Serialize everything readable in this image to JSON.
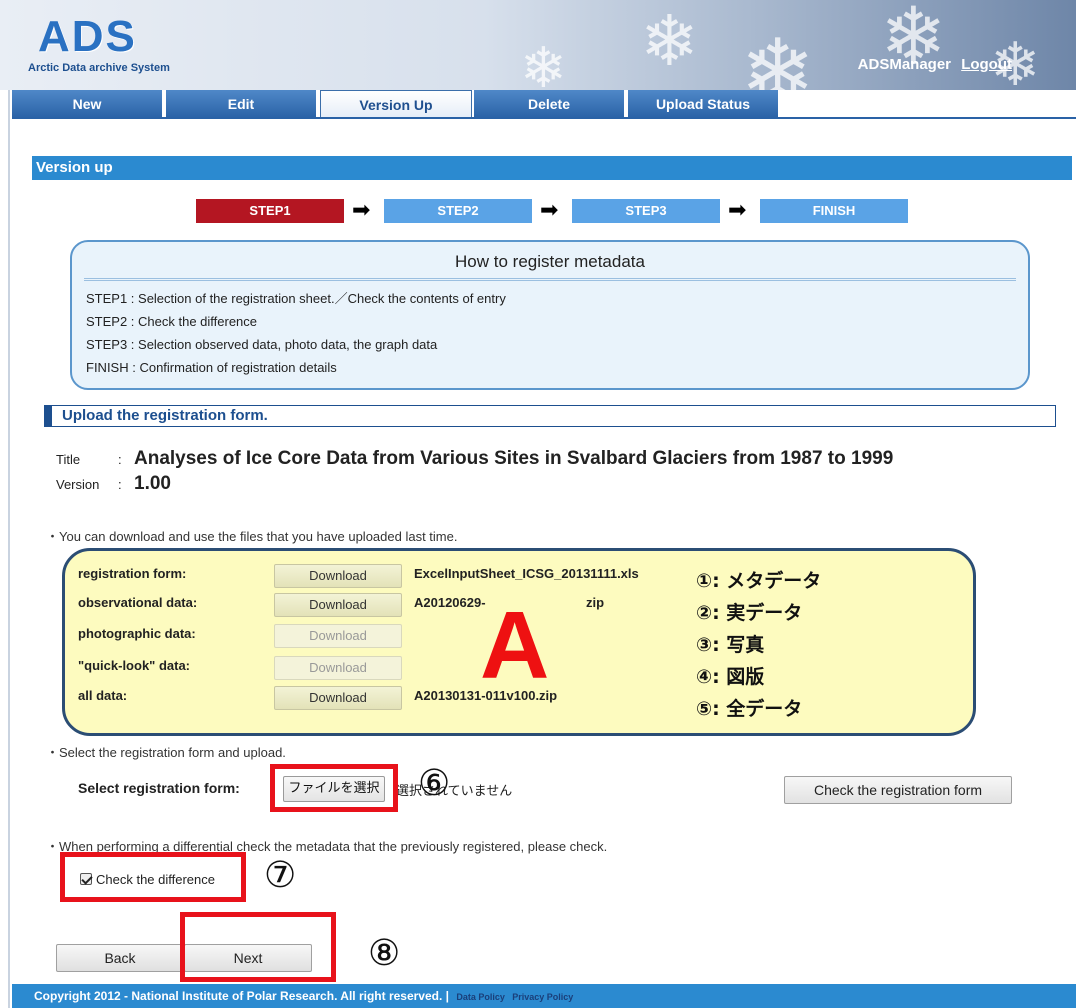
{
  "header": {
    "logo_text": "ADS",
    "logo_subtitle": "Arctic Data archive System",
    "user_name": "ADSManager",
    "logout_label": "Logout"
  },
  "tabs": [
    {
      "label": "New"
    },
    {
      "label": "Edit"
    },
    {
      "label": "Version Up"
    },
    {
      "label": "Delete"
    },
    {
      "label": "Upload Status"
    }
  ],
  "page": {
    "section_title": "Version up"
  },
  "steps": [
    {
      "label": "STEP1"
    },
    {
      "label": "STEP2"
    },
    {
      "label": "STEP3"
    },
    {
      "label": "FINISH"
    }
  ],
  "howto": {
    "title": "How to register metadata",
    "items": [
      "STEP1 : Selection of the registration sheet.／Check the contents of entry",
      "STEP2 : Check the difference",
      "STEP3 : Selection observed data, photo data, the graph data",
      "FINISH : Confirmation of registration details"
    ]
  },
  "upload": {
    "header": "Upload the registration form.",
    "title_label": "Title",
    "title_value": "Analyses of Ice Core Data from Various Sites in Svalbard Glaciers from 1987 to 1999",
    "version_label": "Version",
    "version_value": "1.00",
    "colon": ":",
    "note_download": "・You can download and use the files that you have uploaded last time.",
    "files": [
      {
        "label": "registration form:",
        "button": "Download",
        "filename": "ExcelInputSheet_ICSG_20131111.xls"
      },
      {
        "label": "observational data:",
        "button": "Download",
        "filename": "A20120629-"
      },
      {
        "label": "photographic data:",
        "button": "Download",
        "filename": ""
      },
      {
        "label": "\"quick-look\" data:",
        "button": "Download",
        "filename": ""
      },
      {
        "label": "all data:",
        "button": "Download",
        "filename": "A20130131-011v100.zip"
      }
    ],
    "observational_filename_tail": "zip",
    "annotations": [
      "①: メタデータ",
      "②: 実データ",
      "③: 写真",
      "④: 図版",
      "⑤: 全データ"
    ],
    "big_marker": "A",
    "note_select": "・Select the registration form and upload.",
    "select_label": "Select registration form:",
    "choose_file_label": "ファイルを選択",
    "file_status": "選択されていません",
    "check_form_button": "Check the registration form",
    "note_diff": "・When performing a differential check the metadata that the previously registered, please check.",
    "check_diff_label": "Check the difference",
    "check_diff_checked": true,
    "back_label": "Back",
    "next_label": "Next",
    "markers": [
      "⑥",
      "⑦",
      "⑧"
    ]
  },
  "footer": {
    "copyright": "Copyright 2012 - National Institute of Polar Research. All right reserved. |",
    "data_policy": "Data Policy",
    "privacy_policy": "Privacy Policy"
  },
  "colors": {
    "tab_blue": "#2a62a6",
    "section_blue": "#2b8ad0",
    "step_active": "#b41622",
    "step_inactive": "#5aa3e6",
    "highlight_red": "#e8121b",
    "box_yellow": "#fdfbbf"
  }
}
